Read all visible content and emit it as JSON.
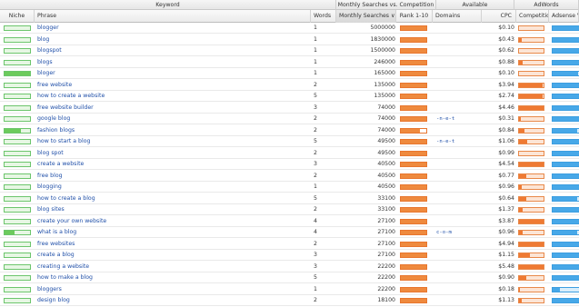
{
  "group_headers": {
    "keyword": "Keyword",
    "monthly_vs_competition": "Monthly Searches vs. Competition",
    "available": "Available",
    "adwords": "AdWords"
  },
  "columns": {
    "niche": "Niche",
    "phrase": "Phrase",
    "words": "Words",
    "monthly_searches": "Monthly Searches ∨",
    "rank": "Rank 1-10",
    "domains": "Domains",
    "cpc": "CPC",
    "competition": "Competition",
    "adsense": "Adsense Va"
  },
  "colors": {
    "niche": "#6ccb5c",
    "rank": "#ef8a3e",
    "competition": "#ef7a33",
    "adsense": "#47a8e8",
    "link": "#1f4fa8"
  },
  "rows": [
    {
      "phrase": "blogger",
      "words": "1",
      "searches": "5000000",
      "domains": "",
      "cpc": "$0.10",
      "niche": 0.0,
      "rank": 1.0,
      "comp": 0.0,
      "ads": 1.0
    },
    {
      "phrase": "blog",
      "words": "1",
      "searches": "1830000",
      "domains": "",
      "cpc": "$0.43",
      "niche": 0.0,
      "rank": 1.0,
      "comp": 0.12,
      "ads": 1.0
    },
    {
      "phrase": "blogspot",
      "words": "1",
      "searches": "1500000",
      "domains": "",
      "cpc": "$0.62",
      "niche": 0.0,
      "rank": 1.0,
      "comp": 0.0,
      "ads": 1.0
    },
    {
      "phrase": "blogs",
      "words": "1",
      "searches": "246000",
      "domains": "",
      "cpc": "$0.88",
      "niche": 0.0,
      "rank": 1.0,
      "comp": 0.15,
      "ads": 1.0
    },
    {
      "phrase": "bloger",
      "words": "1",
      "searches": "165000",
      "domains": "",
      "cpc": "$0.10",
      "niche": 1.0,
      "rank": 1.0,
      "comp": 0.0,
      "ads": 0.93
    },
    {
      "phrase": "free website",
      "words": "2",
      "searches": "135000",
      "domains": "",
      "cpc": "$3.94",
      "niche": 0.0,
      "rank": 1.0,
      "comp": 0.95,
      "ads": 1.0
    },
    {
      "phrase": "how to create a website",
      "words": "5",
      "searches": "135000",
      "domains": "",
      "cpc": "$2.74",
      "niche": 0.0,
      "rank": 1.0,
      "comp": 0.95,
      "ads": 1.0
    },
    {
      "phrase": "free website builder",
      "words": "3",
      "searches": "74000",
      "domains": "",
      "cpc": "$4.46",
      "niche": 0.0,
      "rank": 1.0,
      "comp": 1.0,
      "ads": 1.0
    },
    {
      "phrase": "google blog",
      "words": "2",
      "searches": "74000",
      "domains": "-n-e-t",
      "cpc": "$0.31",
      "niche": 0.0,
      "rank": 1.0,
      "comp": 0.08,
      "ads": 0.95
    },
    {
      "phrase": "fashion blogs",
      "words": "2",
      "searches": "74000",
      "domains": "",
      "cpc": "$0.84",
      "niche": 0.65,
      "rank": 0.75,
      "comp": 0.22,
      "ads": 0.9
    },
    {
      "phrase": "how to start a blog",
      "words": "5",
      "searches": "49500",
      "domains": "-n-e-t",
      "cpc": "$1.06",
      "niche": 0.0,
      "rank": 1.0,
      "comp": 0.35,
      "ads": 1.0
    },
    {
      "phrase": "blog spot",
      "words": "2",
      "searches": "49500",
      "domains": "",
      "cpc": "$0.99",
      "niche": 0.0,
      "rank": 1.0,
      "comp": 0.0,
      "ads": 1.0
    },
    {
      "phrase": "create a website",
      "words": "3",
      "searches": "40500",
      "domains": "",
      "cpc": "$4.54",
      "niche": 0.0,
      "rank": 1.0,
      "comp": 1.0,
      "ads": 1.0
    },
    {
      "phrase": "free blog",
      "words": "2",
      "searches": "40500",
      "domains": "",
      "cpc": "$0.77",
      "niche": 0.0,
      "rank": 1.0,
      "comp": 0.3,
      "ads": 1.0
    },
    {
      "phrase": "blogging",
      "words": "1",
      "searches": "40500",
      "domains": "",
      "cpc": "$0.96",
      "niche": 0.0,
      "rank": 1.0,
      "comp": 0.12,
      "ads": 1.0
    },
    {
      "phrase": "how to create a blog",
      "words": "5",
      "searches": "33100",
      "domains": "",
      "cpc": "$0.64",
      "niche": 0.0,
      "rank": 1.0,
      "comp": 0.28,
      "ads": 0.9
    },
    {
      "phrase": "blog sites",
      "words": "2",
      "searches": "33100",
      "domains": "",
      "cpc": "$1.37",
      "niche": 0.0,
      "rank": 1.0,
      "comp": 0.15,
      "ads": 1.0
    },
    {
      "phrase": "create your own website",
      "words": "4",
      "searches": "27100",
      "domains": "",
      "cpc": "$3.87",
      "niche": 0.0,
      "rank": 1.0,
      "comp": 1.0,
      "ads": 1.0
    },
    {
      "phrase": "what is a blog",
      "words": "4",
      "searches": "27100",
      "domains": "c-o-m",
      "cpc": "$0.96",
      "niche": 0.4,
      "rank": 1.0,
      "comp": 0.15,
      "ads": 0.9
    },
    {
      "phrase": "free websites",
      "words": "2",
      "searches": "27100",
      "domains": "",
      "cpc": "$4.94",
      "niche": 0.0,
      "rank": 1.0,
      "comp": 1.0,
      "ads": 1.0
    },
    {
      "phrase": "create a blog",
      "words": "3",
      "searches": "27100",
      "domains": "",
      "cpc": "$1.15",
      "niche": 0.0,
      "rank": 1.0,
      "comp": 0.45,
      "ads": 1.0
    },
    {
      "phrase": "creating a website",
      "words": "3",
      "searches": "22200",
      "domains": "",
      "cpc": "$5.48",
      "niche": 0.0,
      "rank": 1.0,
      "comp": 1.0,
      "ads": 1.0
    },
    {
      "phrase": "how to make a blog",
      "words": "5",
      "searches": "22200",
      "domains": "",
      "cpc": "$0.90",
      "niche": 0.0,
      "rank": 1.0,
      "comp": 0.3,
      "ads": 1.0
    },
    {
      "phrase": "bloggers",
      "words": "1",
      "searches": "22200",
      "domains": "",
      "cpc": "$0.18",
      "niche": 0.0,
      "rank": 1.0,
      "comp": 0.05,
      "ads": 0.25
    },
    {
      "phrase": "design blog",
      "words": "2",
      "searches": "18100",
      "domains": "",
      "cpc": "$1.13",
      "niche": 0.0,
      "rank": 1.0,
      "comp": 0.1,
      "ads": 0.95
    },
    {
      "phrase": "create blog",
      "words": "2",
      "searches": "18100",
      "domains": "",
      "cpc": "$0.53",
      "niche": 0.0,
      "rank": 1.0,
      "comp": 0.25,
      "ads": 1.0
    }
  ]
}
